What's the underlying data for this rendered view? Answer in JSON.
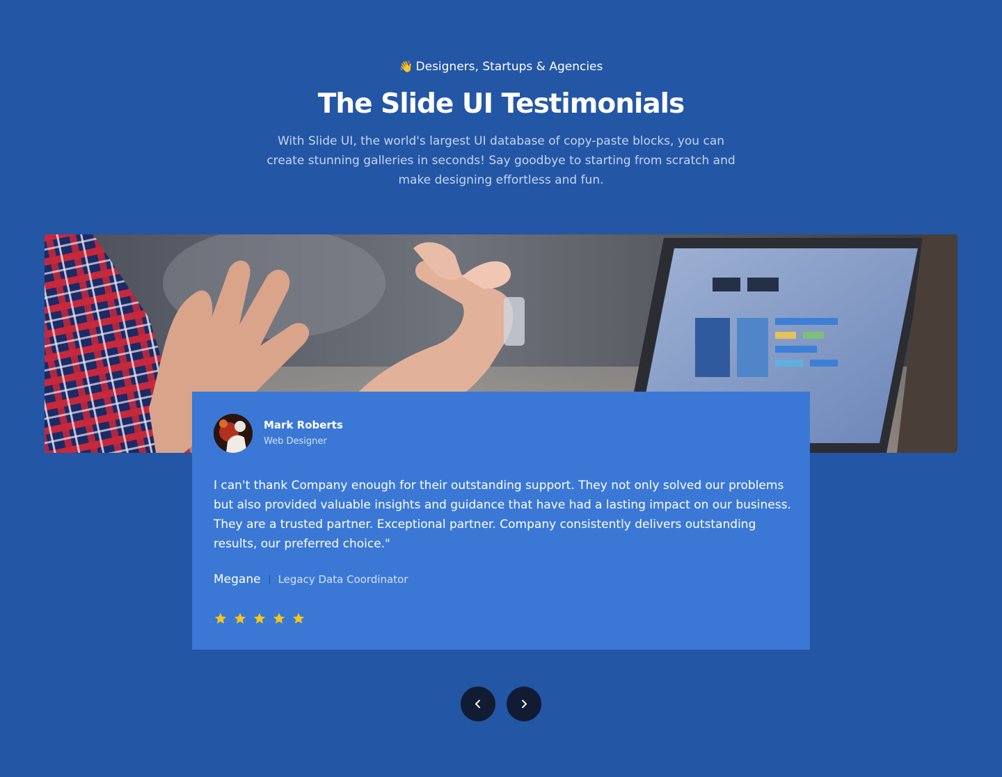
{
  "header": {
    "eyebrow_emoji": "👋",
    "eyebrow": "Designers, Startups & Agencies",
    "title": "The Slide UI Testimonials",
    "description": "With Slide UI, the world's largest UI database of copy-paste blocks, you can create stunning galleries in seconds! Say goodbye to starting from scratch and make designing effortless and fun."
  },
  "hero_image": {
    "icon": "photo-hands-laptop"
  },
  "testimonial": {
    "author_name": "Mark Roberts",
    "author_role": "Web Designer",
    "quote": "I can't thank Company enough for their outstanding support. They not only solved our problems but also provided valuable insights and guidance that have had a lasting impact on our business. They are a trusted partner. Exceptional partner. Company consistently delivers outstanding results, our preferred choice.\"",
    "signature_name": "Megane",
    "signature_role": "Legacy Data Coordinator",
    "rating": 5,
    "rating_max": 5
  },
  "navigation": {
    "prev_icon": "chevron-left-icon",
    "next_icon": "chevron-right-icon"
  },
  "colors": {
    "background": "#2356a5",
    "card": "#3b78d6",
    "button": "#111b33",
    "star": "#f5c518"
  }
}
